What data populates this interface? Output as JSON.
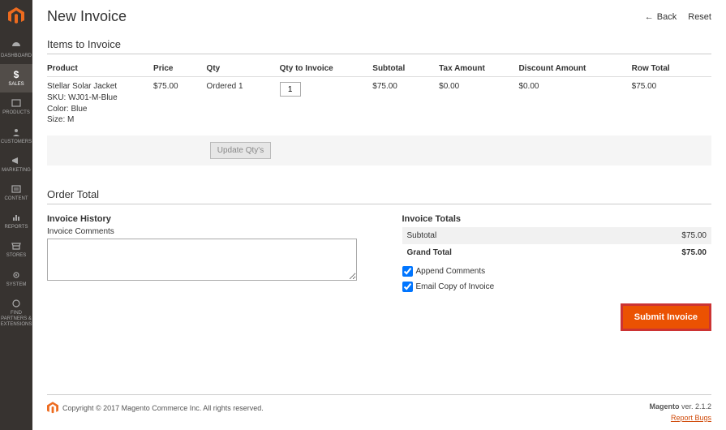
{
  "header": {
    "title": "New Invoice",
    "back": "Back",
    "reset": "Reset"
  },
  "sidebar": {
    "items": [
      {
        "label": "DASHBOARD"
      },
      {
        "label": "SALES"
      },
      {
        "label": "PRODUCTS"
      },
      {
        "label": "CUSTOMERS"
      },
      {
        "label": "MARKETING"
      },
      {
        "label": "CONTENT"
      },
      {
        "label": "REPORTS"
      },
      {
        "label": "STORES"
      },
      {
        "label": "SYSTEM"
      },
      {
        "label": "FIND PARTNERS & EXTENSIONS"
      }
    ]
  },
  "items_section": {
    "title": "Items to Invoice",
    "cols": {
      "product": "Product",
      "price": "Price",
      "qty": "Qty",
      "qty_to_invoice": "Qty to Invoice",
      "subtotal": "Subtotal",
      "tax": "Tax Amount",
      "discount": "Discount Amount",
      "row_total": "Row Total"
    },
    "row": {
      "name": "Stellar Solar Jacket",
      "sku": "SKU: WJ01-M-Blue",
      "color": "Color: Blue",
      "size": "Size: M",
      "price": "$75.00",
      "qty": "Ordered 1",
      "qty_input": "1",
      "subtotal": "$75.00",
      "tax": "$0.00",
      "discount": "$0.00",
      "row_total": "$75.00"
    },
    "update_btn": "Update Qty's"
  },
  "order_total": {
    "title": "Order Total",
    "history_title": "Invoice History",
    "comments_label": "Invoice Comments",
    "totals_title": "Invoice Totals",
    "subtotal_label": "Subtotal",
    "subtotal_val": "$75.00",
    "grand_label": "Grand Total",
    "grand_val": "$75.00",
    "append_comments": "Append Comments",
    "email_copy": "Email Copy of Invoice",
    "submit": "Submit Invoice"
  },
  "footer": {
    "copyright": "Copyright © 2017 Magento Commerce Inc. All rights reserved.",
    "version": "Magento ver. 2.1.2",
    "report": "Report Bugs"
  }
}
